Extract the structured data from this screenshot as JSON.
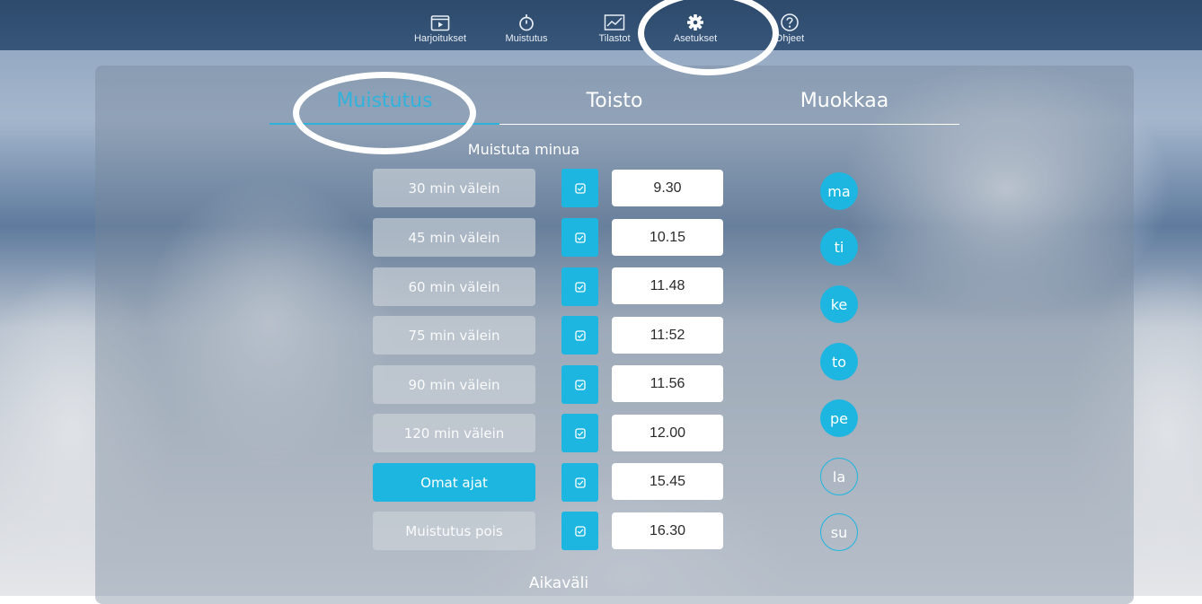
{
  "nav": {
    "items": [
      {
        "label": "Harjoitukset",
        "icon": "play-box-icon"
      },
      {
        "label": "Muistutus",
        "icon": "stopwatch-icon"
      },
      {
        "label": "Tilastot",
        "icon": "chart-icon"
      },
      {
        "label": "Asetukset",
        "icon": "gear-icon"
      },
      {
        "label": "Ohjeet",
        "icon": "help-circle-icon"
      }
    ],
    "active": "Asetukset"
  },
  "tabs": [
    {
      "label": "Muistutus",
      "active": true
    },
    {
      "label": "Toisto",
      "active": false
    },
    {
      "label": "Muokkaa",
      "active": false
    }
  ],
  "section_title": "Muistuta minua",
  "intervals": [
    {
      "label": "30 min välein",
      "selected": false
    },
    {
      "label": "45 min välein",
      "selected": false
    },
    {
      "label": "60 min välein",
      "selected": false
    },
    {
      "label": "75 min välein",
      "selected": false
    },
    {
      "label": "90 min välein",
      "selected": false
    },
    {
      "label": "120 min välein",
      "selected": false
    },
    {
      "label": "Omat ajat",
      "selected": true
    },
    {
      "label": "Muistutus pois",
      "selected": false
    }
  ],
  "times": [
    "9.30",
    "10.15",
    "11.48",
    "11:52",
    "11.56",
    "12.00",
    "15.45",
    "16.30"
  ],
  "days": [
    {
      "label": "ma",
      "selected": true
    },
    {
      "label": "ti",
      "selected": true
    },
    {
      "label": "ke",
      "selected": true
    },
    {
      "label": "to",
      "selected": true
    },
    {
      "label": "pe",
      "selected": true
    },
    {
      "label": "la",
      "selected": false
    },
    {
      "label": "su",
      "selected": false
    }
  ],
  "footer_title": "Aikaväli",
  "colors": {
    "accent": "#1cb6e0",
    "topbar": "#2d4a6c"
  }
}
